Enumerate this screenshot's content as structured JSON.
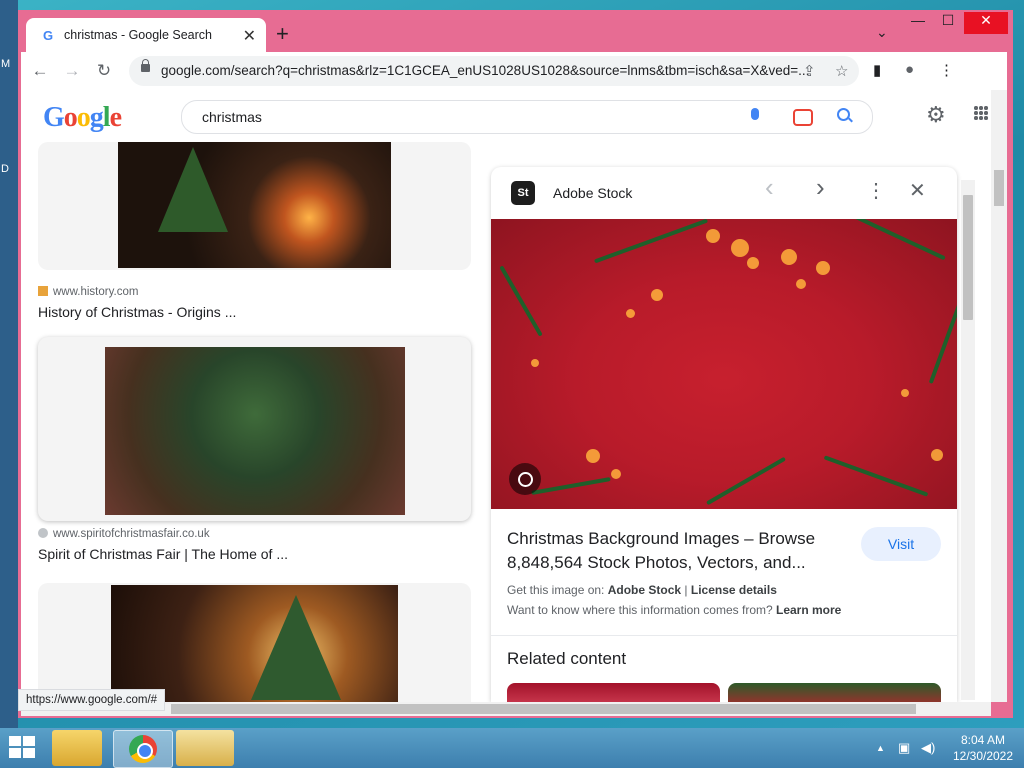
{
  "desktop": {
    "letters": [
      "M",
      "D"
    ]
  },
  "browser": {
    "tab_title": "christmas - Google Search",
    "tab_favicon": "G",
    "tab_close": "✕",
    "new_tab": "+",
    "tab_search": "⌄",
    "window_buttons": {
      "minimize": "—",
      "maximize": "☐",
      "close": "✕"
    },
    "nav": {
      "back": "←",
      "forward": "→",
      "reload": "↻"
    },
    "url": "google.com/search?q=christmas&rlz=1C1GCEA_enUS1028US1028&source=lnms&tbm=isch&sa=X&ved=...",
    "toolbar_icons": {
      "share": "⇪",
      "star": "☆",
      "sidebar": "▮",
      "profile": "●",
      "menu": "⋮"
    }
  },
  "google": {
    "logo_letters": [
      "G",
      "o",
      "o",
      "g",
      "l",
      "e"
    ],
    "logo_colors": [
      "#4285f4",
      "#ea4335",
      "#fbbc05",
      "#4285f4",
      "#34a853",
      "#ea4335"
    ],
    "search_query": "christmas",
    "settings_icon": "⚙"
  },
  "results": [
    {
      "source": "www.history.com",
      "title": "History of Christmas - Origins ...",
      "fav_color": "#e8a33b"
    },
    {
      "source": "www.spiritofchristmasfair.co.uk",
      "title": "Spirit of Christmas Fair | The Home of ...",
      "fav_color": "#9aa0a6"
    }
  ],
  "panel": {
    "logo": "St",
    "source": "Adobe Stock",
    "icons": {
      "prev": "‹",
      "next": "›",
      "more": "⋮",
      "close": "✕"
    },
    "title": "Christmas Background Images – Browse 8,848,564 Stock Photos, Vectors, and...",
    "visit": "Visit",
    "get_prefix": "Get this image on: ",
    "get_source": "Adobe Stock",
    "separator": " | ",
    "license": "License details",
    "want": "Want to know where this information comes from? ",
    "learn_more": "Learn more",
    "related": "Related content"
  },
  "status_url": "https://www.google.com/#",
  "taskbar": {
    "time": "8:04 AM",
    "date": "12/30/2022",
    "tray": {
      "up": "▲",
      "network": "▣",
      "volume": "◀)"
    }
  }
}
